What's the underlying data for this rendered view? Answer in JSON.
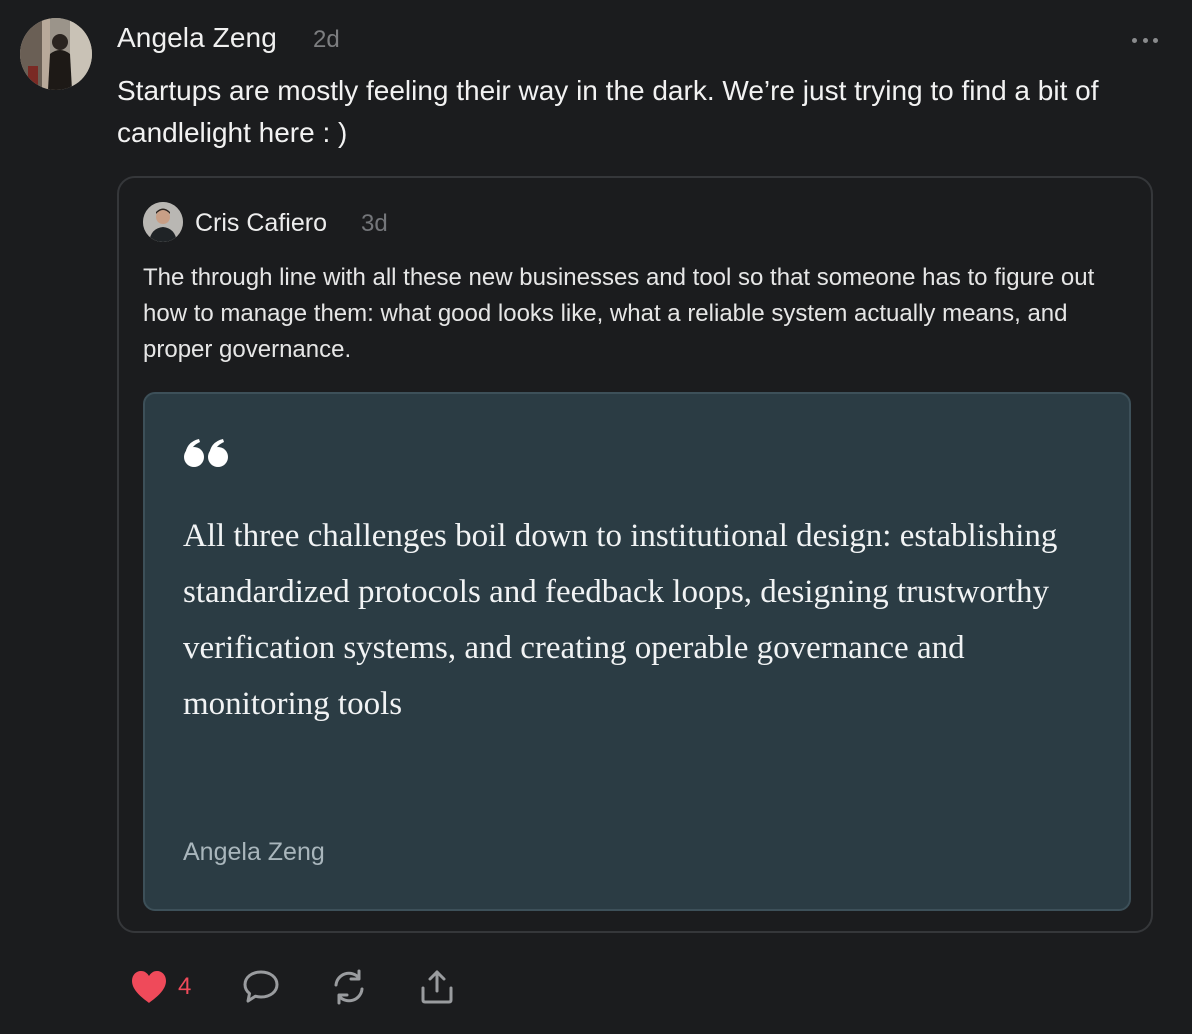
{
  "post": {
    "author": "Angela Zeng",
    "time": "2d",
    "text": "Startups are mostly feeling their way in the dark. We’re just trying to find a bit of candlelight here : )",
    "avatar_icon": "user-photo-avatar",
    "more_icon": "more-dots-icon"
  },
  "embed": {
    "author": "Cris Cafiero",
    "time": "3d",
    "text": "The through line with all these new businesses and tool so that someone has to figure out how to manage them: what good looks like, what a reliable system actually means, and proper governance.",
    "quote": {
      "icon": "quote-mark-icon",
      "text": "All three challenges boil down to institutional design: establishing standardized protocols and feedback loops, designing trustworthy verification systems, and creating operable governance and monitoring tools",
      "attribution": "Angela Zeng",
      "background": "#2b3c44"
    }
  },
  "actions": {
    "like_icon": "heart-icon",
    "like_count": "4",
    "like_color": "#ef4a5a",
    "comment_icon": "comment-icon",
    "restack_icon": "restack-icon",
    "share_icon": "share-icon"
  }
}
